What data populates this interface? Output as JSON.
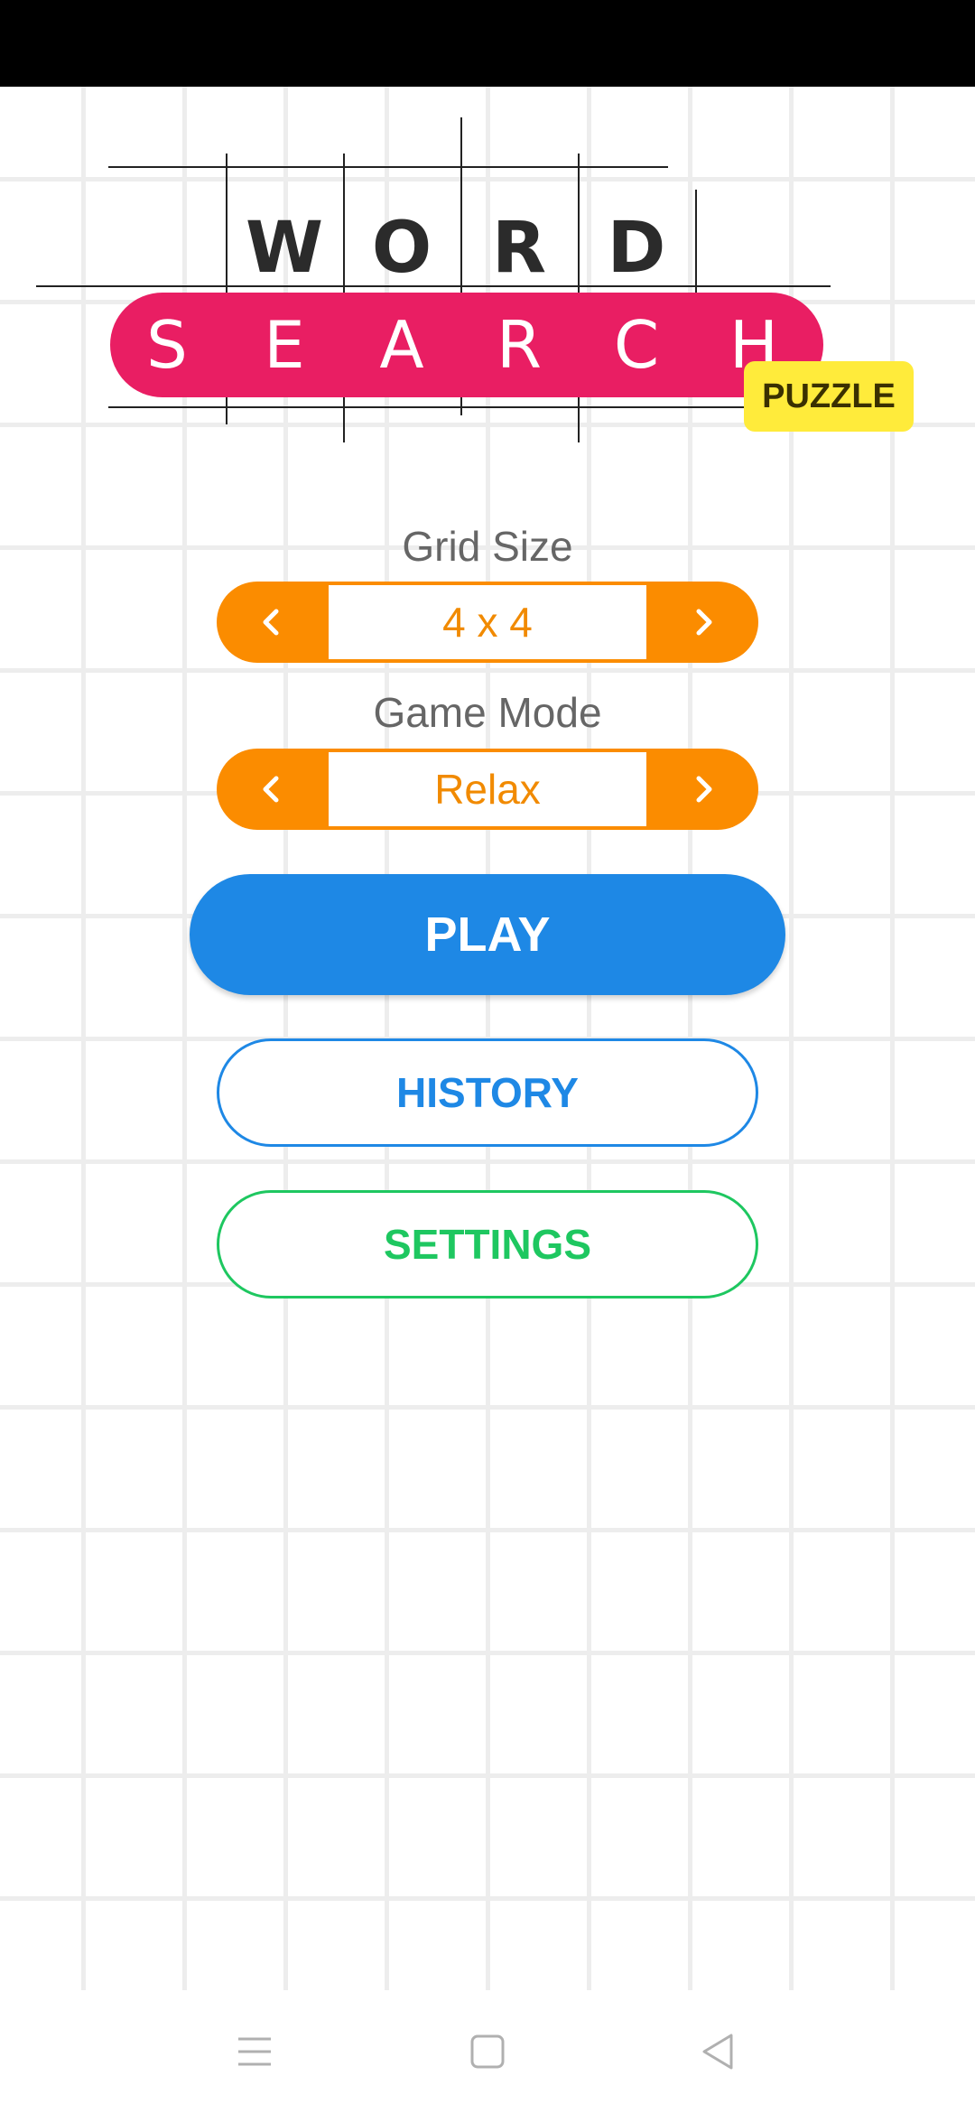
{
  "logo": {
    "word_letters": [
      "W",
      "O",
      "R",
      "D"
    ],
    "search_letters": [
      "S",
      "E",
      "A",
      "R",
      "C",
      "H"
    ],
    "badge": "PUZZLE",
    "colors": {
      "search_pill": "#e91e63",
      "badge": "#ffeb3b"
    }
  },
  "grid_size": {
    "label": "Grid Size",
    "value": "4 x 4",
    "prev_icon": "chevron-left-icon",
    "next_icon": "chevron-right-icon"
  },
  "game_mode": {
    "label": "Game Mode",
    "value": "Relax",
    "prev_icon": "chevron-left-icon",
    "next_icon": "chevron-right-icon"
  },
  "buttons": {
    "play": "PLAY",
    "history": "HISTORY",
    "settings": "SETTINGS"
  },
  "colors": {
    "selector": "#fb8c00",
    "play": "#1e88e5",
    "history": "#1e88e5",
    "settings": "#1ec760"
  },
  "nav_bar": {
    "icons": [
      "menu-icon",
      "home-square-icon",
      "back-triangle-icon"
    ]
  }
}
